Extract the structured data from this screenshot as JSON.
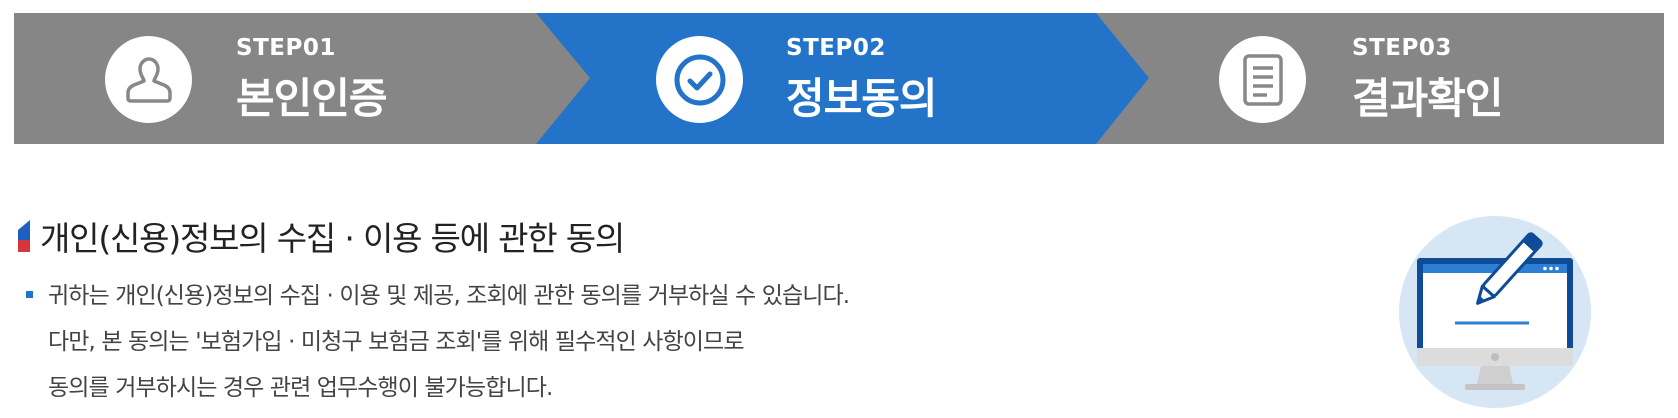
{
  "steps": [
    {
      "number": "STEP01",
      "title": "본인인증",
      "icon": "person-icon",
      "state": "inactive"
    },
    {
      "number": "STEP02",
      "title": "정보동의",
      "icon": "check-circle-icon",
      "state": "active"
    },
    {
      "number": "STEP03",
      "title": "결과확인",
      "icon": "document-icon",
      "state": "inactive"
    }
  ],
  "colors": {
    "active": "#2374c9",
    "inactive": "#868686",
    "marker_blue": "#1f5fbf",
    "marker_red": "#d8343c"
  },
  "section": {
    "title": "개인(신용)정보의 수집 · 이용 등에 관한 동의",
    "lines": [
      "귀하는 개인(신용)정보의 수집 · 이용 및 제공, 조회에 관한 동의를 거부하실 수 있습니다.",
      "다만, 본 동의는 '보험가입 · 미청구 보험금 조회'를 위해 필수적인 사항이므로",
      "동의를 거부하시는 경우 관련 업무수행이 불가능합니다."
    ],
    "illustration": "computer-signing-icon"
  }
}
